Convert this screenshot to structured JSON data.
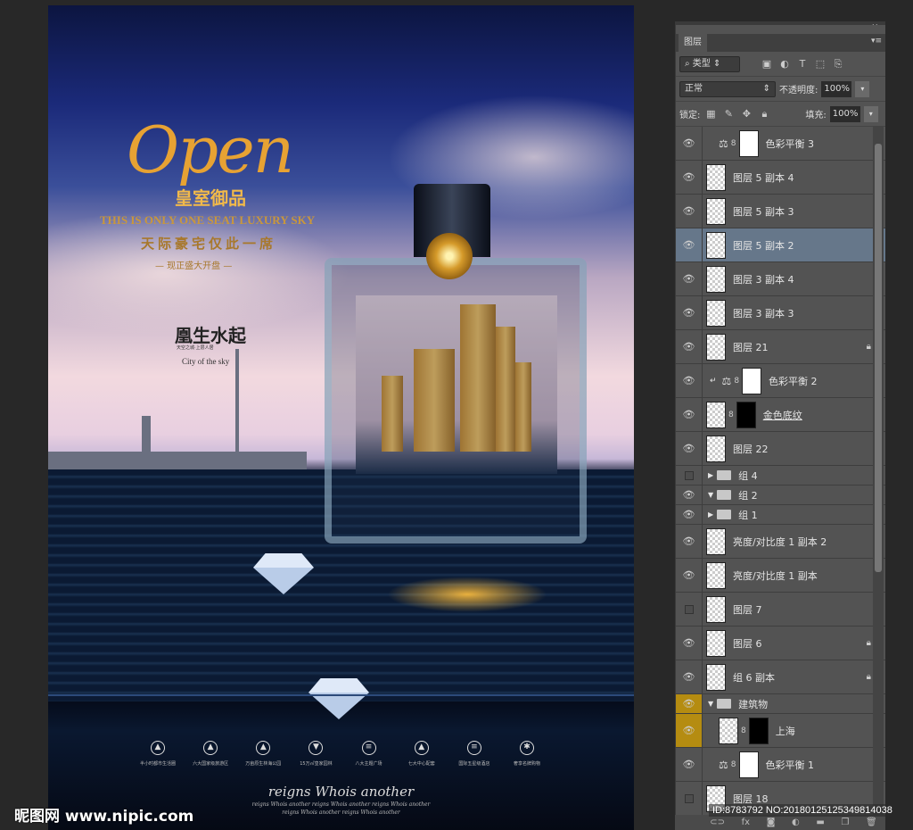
{
  "poster": {
    "open_title": "Open",
    "brand": "皇室御品",
    "tagline_en": "THIS IS ONLY ONE SEAT LUXURY SKY",
    "tagline_cn": "天际豪宅仅此一席",
    "opening": "— 现正盛大开盘 —",
    "city_cn": "凰生水起",
    "city_sub": "天空之城·上层人居",
    "city_en": "City of the sky",
    "features": [
      {
        "icon": "building-icon",
        "label": "半小时都市生活圈"
      },
      {
        "icon": "mountain-icon",
        "label": "六大国家级旅游区"
      },
      {
        "icon": "forest-icon",
        "label": "万亩原生林海公园"
      },
      {
        "icon": "garden-icon",
        "label": "15万㎡皇家园林"
      },
      {
        "icon": "plaza-icon",
        "label": "八大主题广场"
      },
      {
        "icon": "center-icon",
        "label": "七大中心配套"
      },
      {
        "icon": "hotel-icon",
        "label": "国际五星级酒店"
      },
      {
        "icon": "shopping-icon",
        "label": "奢享名牌购物"
      }
    ],
    "slogan_main": "reigns Whois another",
    "slogan_sub1": "reigns Whois another reigns Whois another reigns Whois another",
    "slogan_sub2": "reigns Whois another reigns Whois another"
  },
  "watermark": {
    "site": "昵图网 www.nipic.com",
    "id": "ID:8783792 NO:20180125125349814038"
  },
  "panel": {
    "tab": "图层",
    "filter_kind": "类型",
    "blend_mode": "正常",
    "opacity_label": "不透明度:",
    "opacity": "100%",
    "lock_label": "锁定:",
    "fill_label": "填充:",
    "fill": "100%",
    "layers": [
      {
        "name": "色彩平衡 3",
        "type": "adjustment",
        "visible": true
      },
      {
        "name": "图层 5 副本 4",
        "type": "pixel",
        "visible": true
      },
      {
        "name": "图层 5 副本 3",
        "type": "pixel",
        "visible": true
      },
      {
        "name": "图层 5 副本 2",
        "type": "pixel",
        "visible": true,
        "selected": true
      },
      {
        "name": "图层 3 副本 4",
        "type": "pixel",
        "visible": true
      },
      {
        "name": "图层 3 副本 3",
        "type": "pixel",
        "visible": true
      },
      {
        "name": "图层 21",
        "type": "pixel",
        "visible": true,
        "locked": true
      },
      {
        "name": "色彩平衡 2",
        "type": "adjustment",
        "visible": true,
        "clipped": true
      },
      {
        "name": "金色底纹",
        "type": "smart-masked",
        "visible": true
      },
      {
        "name": "图层 22",
        "type": "pixel",
        "visible": true
      },
      {
        "name": "组 4",
        "type": "group",
        "visible": false,
        "expanded": false
      },
      {
        "name": "组 2",
        "type": "group",
        "visible": true,
        "expanded": true
      },
      {
        "name": "组 1",
        "type": "group",
        "visible": true,
        "expanded": false
      },
      {
        "name": "亮度/对比度 1 副本 2",
        "type": "pixel",
        "visible": true
      },
      {
        "name": "亮度/对比度 1 副本",
        "type": "pixel",
        "visible": true
      },
      {
        "name": "图层 7",
        "type": "pixel",
        "visible": false
      },
      {
        "name": "图层 6",
        "type": "pixel",
        "visible": true,
        "locked": true
      },
      {
        "name": "组 6 副本",
        "type": "pixel",
        "visible": true,
        "locked": true
      },
      {
        "name": "建筑物",
        "type": "group",
        "visible": true,
        "expanded": true,
        "highlight": true
      },
      {
        "name": "上海",
        "type": "masked",
        "visible": true,
        "highlight": true
      },
      {
        "name": "色彩平衡 1",
        "type": "adjustment",
        "visible": true
      },
      {
        "name": "图层 18",
        "type": "pixel",
        "visible": false
      }
    ]
  },
  "colors": {
    "highlight": "#b58c11",
    "selected": "#66778a",
    "panel": "#535353"
  }
}
